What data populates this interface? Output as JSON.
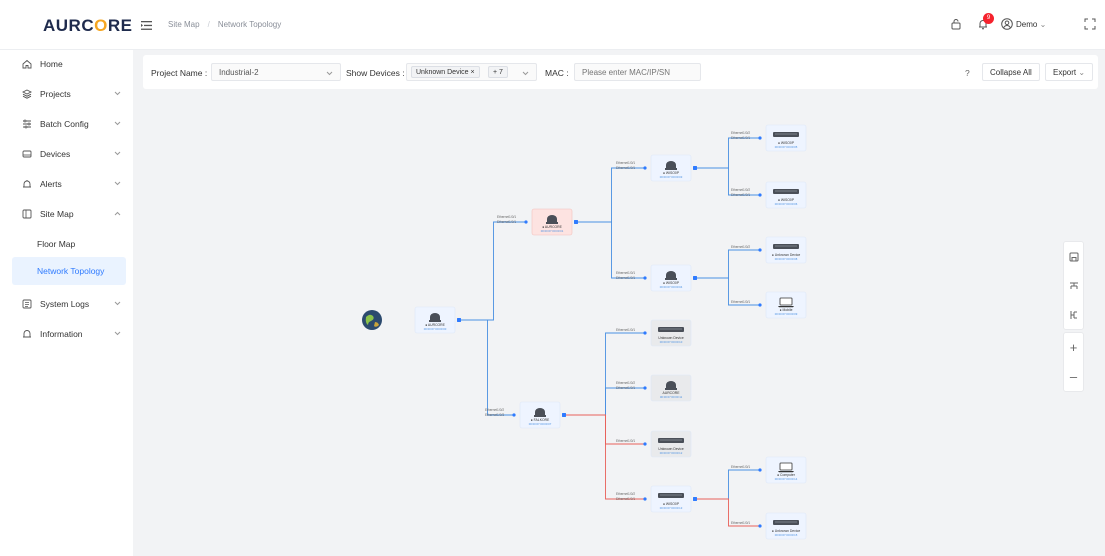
{
  "header": {
    "logo": {
      "pre": "AURC",
      "o": "O",
      "post": "RE"
    },
    "breadcrumb": [
      "Site Map",
      "Network Topology"
    ],
    "notifications": "9",
    "user": "Demo"
  },
  "sidebar": {
    "items": [
      {
        "label": "Home",
        "icon": "home-icon",
        "chevron": false
      },
      {
        "label": "Projects",
        "icon": "projects-icon",
        "chevron": true
      },
      {
        "label": "Batch Config",
        "icon": "batch-config-icon",
        "chevron": true
      },
      {
        "label": "Devices",
        "icon": "devices-icon",
        "chevron": true
      },
      {
        "label": "Alerts",
        "icon": "alerts-icon",
        "chevron": true
      },
      {
        "label": "Site Map",
        "icon": "site-map-icon",
        "chevron": true,
        "expanded": true
      },
      {
        "label": "Floor Map",
        "sub": true
      },
      {
        "label": "Network Topology",
        "sub": true,
        "active": true
      },
      {
        "label": "System Logs",
        "icon": "system-logs-icon",
        "chevron": true
      },
      {
        "label": "Information",
        "icon": "information-icon",
        "chevron": true
      }
    ]
  },
  "toolbar": {
    "project_label": "Project Name :",
    "project_value": "Industrial-2",
    "devices_label": "Show Devices :",
    "device_tag": "Unknown Device",
    "more_tag": "+ 7",
    "mac_label": "MAC :",
    "mac_placeholder": "Please enter MAC/IP/SN",
    "help": "?",
    "collapse_all": "Collapse All",
    "export": "Export"
  },
  "colors": {
    "accent": "#2f7bff",
    "link_blue": "#4a90e2",
    "link_red": "#e8605a",
    "alert_bg": "#fde3e1"
  },
  "topology": {
    "nodes": [
      {
        "id": "internet",
        "kind": "globe"
      },
      {
        "id": "root",
        "kind": "router",
        "name": "● AURCORE",
        "mac": "00:00:07:00:00:00"
      },
      {
        "id": "sw1",
        "kind": "router",
        "name": "● AURCORE",
        "mac": "00:00:07:00:00:01",
        "alert": true,
        "ports": [
          "Ethernet1/0/1",
          "Ethernet1/0/1"
        ]
      },
      {
        "id": "sw2",
        "kind": "router",
        "name": "● FALKORE",
        "mac": "00:00:07:00:00:07",
        "ports": [
          "Ethernet1/0/2",
          "Ethernet1/0/3"
        ]
      },
      {
        "id": "sw1a",
        "kind": "router",
        "name": "● WISO0P",
        "mac": "00:00:07:00:00:03",
        "ports": [
          "Ethernet1/0/1",
          "Ethernet1/0/1"
        ]
      },
      {
        "id": "sw1b",
        "kind": "router",
        "name": "● WISO0P",
        "mac": "00:00:07:00:00:04",
        "ports": [
          "Ethernet1/0/1",
          "Ethernet1/0/1"
        ]
      },
      {
        "id": "d1",
        "kind": "switch",
        "name": "● WISO0P",
        "mac": "00:00:07:00:00:05",
        "ports": [
          "Ethernet1/0/2",
          "Ethernet1/0/1"
        ]
      },
      {
        "id": "d2",
        "kind": "switch",
        "name": "● WISO0P",
        "mac": "00:00:07:00:00:06",
        "ports": [
          "Ethernet1/0/2",
          "Ethernet1/0/1"
        ]
      },
      {
        "id": "d3",
        "kind": "switch",
        "name": "● Unknown Device",
        "mac": "00:00:07:00:00:08",
        "ports": [
          "Ethernet1/0/2"
        ]
      },
      {
        "id": "d4",
        "kind": "laptop",
        "name": "● Mobile",
        "mac": "00:00:07:00:00:09",
        "ports": [
          "Ethernet1/0/1"
        ]
      },
      {
        "id": "u1",
        "kind": "switch",
        "name": "Unknown Device",
        "mac": "00:00:07:00:00:10",
        "gray": true,
        "ports": [
          "Ethernet1/0/1"
        ]
      },
      {
        "id": "u2",
        "kind": "router",
        "name": "AURCORE",
        "mac": "00:00:07:00:00:11",
        "gray": true,
        "ports": [
          "Ethernet1/0/2",
          "Ethernet1/0/1"
        ]
      },
      {
        "id": "u3",
        "kind": "switch",
        "name": "Unknown Device",
        "mac": "00:00:07:00:00:12",
        "gray": true,
        "ports": [
          "Ethernet1/0/1"
        ]
      },
      {
        "id": "u4",
        "kind": "switch",
        "name": "● WISO0P",
        "mac": "00:00:07:00:00:13",
        "ports": [
          "Ethernet1/0/2",
          "Ethernet1/0/1"
        ]
      },
      {
        "id": "c1",
        "kind": "laptop",
        "name": "● Computer",
        "mac": "00:00:07:00:00:14",
        "ports": [
          "Ethernet1/0/1"
        ]
      },
      {
        "id": "c2",
        "kind": "switch",
        "name": "● Unknown Device",
        "mac": "00:00:07:00:00:15",
        "ports": [
          "Ethernet1/0/1"
        ]
      }
    ]
  }
}
